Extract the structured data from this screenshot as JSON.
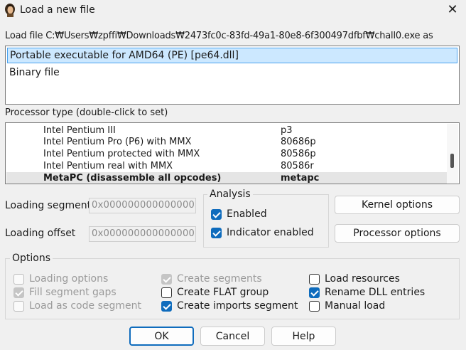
{
  "window": {
    "title": "Load a new file",
    "close_glyph": "✕",
    "icon": "ida-app-icon"
  },
  "load_file_label": "Load file C:₩Users₩zpffi₩Downloads₩2473fc0c-83fd-49a1-80e8-6f300497dfbf₩chall0.exe as",
  "file_types": [
    {
      "label": "Portable executable for AMD64 (PE) [pe64.dll]",
      "selected": true
    },
    {
      "label": "Binary file",
      "selected": false
    }
  ],
  "processor_type_label": "Processor type (double-click to set)",
  "processors": [
    {
      "name": "Intel Pentium III",
      "code": "p3"
    },
    {
      "name": "Intel Pentium Pro (P6) with MMX",
      "code": "80686p"
    },
    {
      "name": "Intel Pentium protected with MMX",
      "code": "80586p"
    },
    {
      "name": "Intel Pentium real with MMX",
      "code": "80586r"
    },
    {
      "name": "MetaPC (disassemble all opcodes)",
      "code": "metapc",
      "selected": true
    }
  ],
  "loading_segment": {
    "label": "Loading segment",
    "value": "0x0000000000000000"
  },
  "loading_offset": {
    "label": "Loading offset",
    "value": "0x0000000000000000"
  },
  "analysis": {
    "title": "Analysis",
    "enabled": {
      "label": "Enabled",
      "checked": true
    },
    "indicator": {
      "label": "Indicator enabled",
      "checked": true
    }
  },
  "buttons": {
    "kernel_options": "Kernel options",
    "processor_options": "Processor options",
    "ok": "OK",
    "cancel": "Cancel",
    "help": "Help"
  },
  "options": {
    "title": "Options",
    "loading_options": {
      "label": "Loading options",
      "checked": false,
      "disabled": true
    },
    "fill_segment_gaps": {
      "label": "Fill segment gaps",
      "checked": true,
      "disabled": true
    },
    "load_as_code_segment": {
      "label": "Load as code segment",
      "checked": false,
      "disabled": true
    },
    "create_segments": {
      "label": "Create segments",
      "checked": true,
      "disabled": true
    },
    "create_flat_group": {
      "label": "Create FLAT group",
      "checked": false,
      "disabled": false
    },
    "create_imports_segment": {
      "label": "Create imports segment",
      "checked": true,
      "disabled": false
    },
    "load_resources": {
      "label": "Load resources",
      "checked": false,
      "disabled": false
    },
    "rename_dll_entries": {
      "label": "Rename DLL entries",
      "checked": true,
      "disabled": false
    },
    "manual_load": {
      "label": "Manual load",
      "checked": false,
      "disabled": false
    }
  },
  "colors": {
    "accent": "#0f6cbd",
    "selection": "#cce8ff",
    "selection_border": "#4aa3ef"
  }
}
